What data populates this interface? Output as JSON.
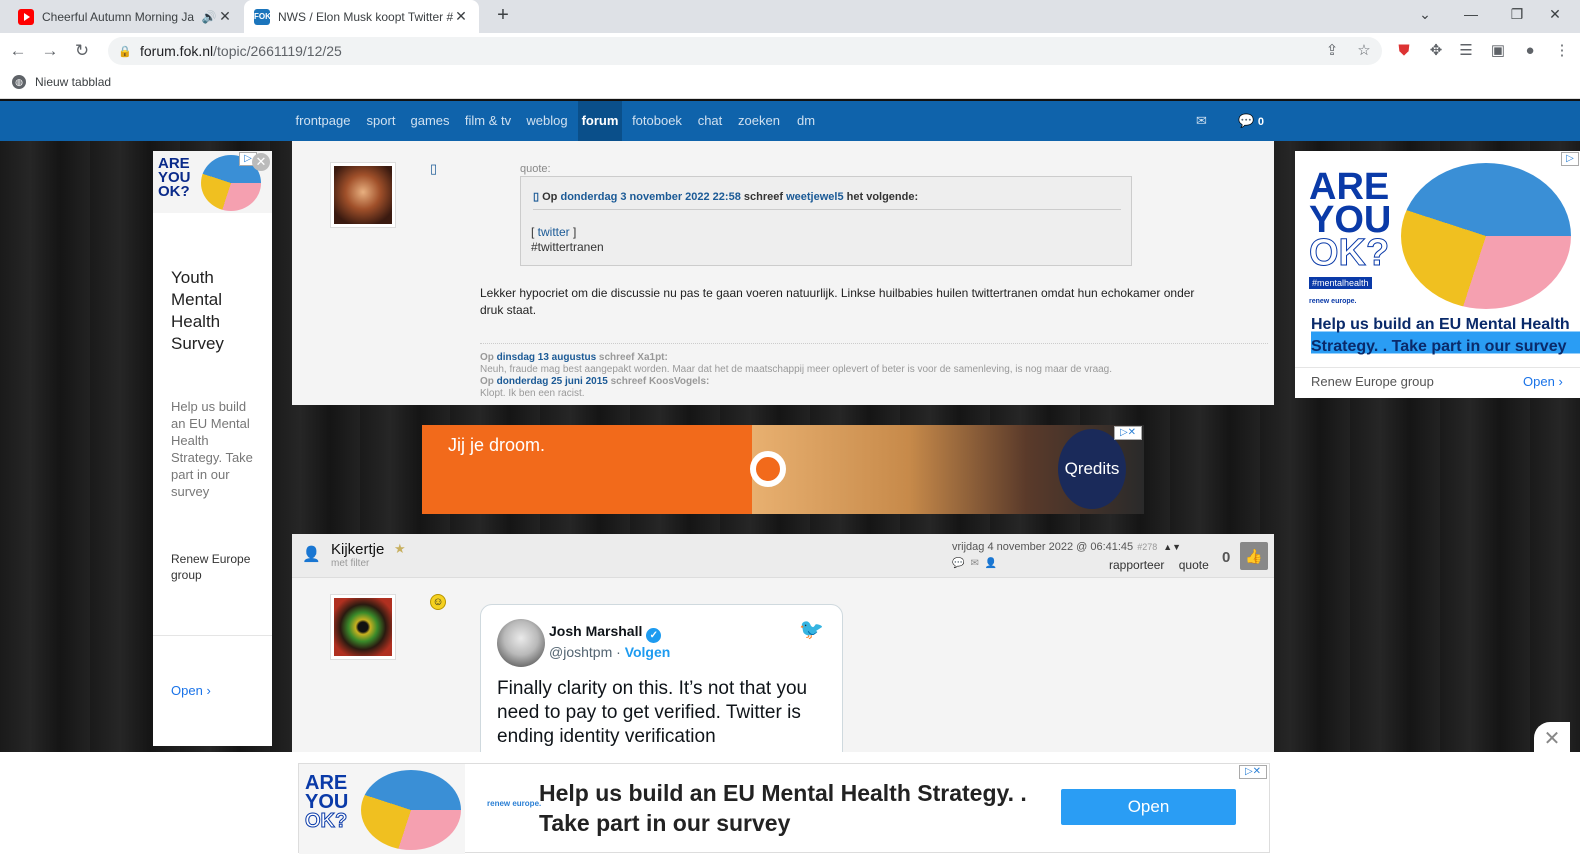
{
  "browser": {
    "tabs": [
      {
        "title": "Cheerful Autumn Morning Ja",
        "favicon": "youtube-icon",
        "audio": true
      },
      {
        "title": "NWS / Elon Musk koopt Twitter #",
        "favicon": "fok-icon",
        "active": true
      }
    ],
    "url_host": "forum.fok.nl",
    "url_path": "/topic/2661119/12/25",
    "bookmark": "Nieuw tabblad"
  },
  "site_nav": {
    "items": [
      "frontpage",
      "sport",
      "games",
      "film & tv",
      "weblog",
      "forum",
      "fotoboek",
      "chat",
      "zoeken",
      "dm"
    ],
    "active": "forum",
    "chat_count": "0"
  },
  "post1": {
    "quote_label": "quote:",
    "quote_prefix": "Op",
    "quote_date": "donderdag 3 november 2022 22:58",
    "quote_mid": "schreef",
    "quote_author": "weetjewel5",
    "quote_suffix": "het volgende:",
    "quote_link": "twitter",
    "quote_text": "#twittertranen",
    "text": "Lekker hypocriet om die discussie nu pas te gaan voeren natuurlijk. Linkse huilbabies huilen twittertranen omdat hun echokamer onder druk staat.",
    "sig": [
      {
        "prefix": "Op",
        "date": "dinsdag 13 augustus",
        "suffix": "schreef Xa1pt:"
      },
      {
        "text": "Neuh, fraude mag best aangepakt worden. Maar dat het de maatschappij meer oplevert of beter is voor de samenleving, is nog maar de vraag."
      },
      {
        "prefix": "Op",
        "date": "donderdag 25 juni 2015",
        "suffix": "schreef KoosVogels:"
      },
      {
        "text": "Klopt. Ik ben een racist."
      }
    ]
  },
  "ad_strip": {
    "slogan": "Jij je droom.",
    "brand": "Qredits",
    "colors": {
      "bg": "#f26a1b"
    }
  },
  "post2": {
    "username": "Kijkertje",
    "usertag": "met filter",
    "datetime": "vrijdag 4 november 2022 @ 06:41:45",
    "post_num": "#278",
    "report": "rapporteer",
    "quote": "quote",
    "score": "0"
  },
  "tweet": {
    "name": "Josh Marshall",
    "handle": "@joshtpm",
    "follow": "Volgen",
    "text": "Finally clarity on this. It’s not that you need to pay to get verified. Twitter is ending identity verification"
  },
  "left_ad": {
    "are_you_ok": [
      "ARE",
      "YOU",
      "OK?"
    ],
    "title": [
      "Youth",
      "Mental",
      "Health",
      "Survey"
    ],
    "body": "Help us build an EU Mental Health Strategy. Take part in our survey",
    "group": "Renew Europe group",
    "open": "Open"
  },
  "right_ad": {
    "are_you_ok": [
      "ARE",
      "YOU",
      "OK?"
    ],
    "hashtag": "#mentalhealth",
    "logo": "renew europe.",
    "headline": "Help us build an EU Mental Health Strategy. . Take part in our survey",
    "group": "Renew Europe group",
    "open": "Open"
  },
  "bottom_ad": {
    "are_you_ok": [
      "ARE",
      "YOU",
      "OK?"
    ],
    "logo": "renew europe.",
    "message": "Help us build an EU Mental Health Strategy. . Take part in our survey",
    "cta": "Open"
  }
}
